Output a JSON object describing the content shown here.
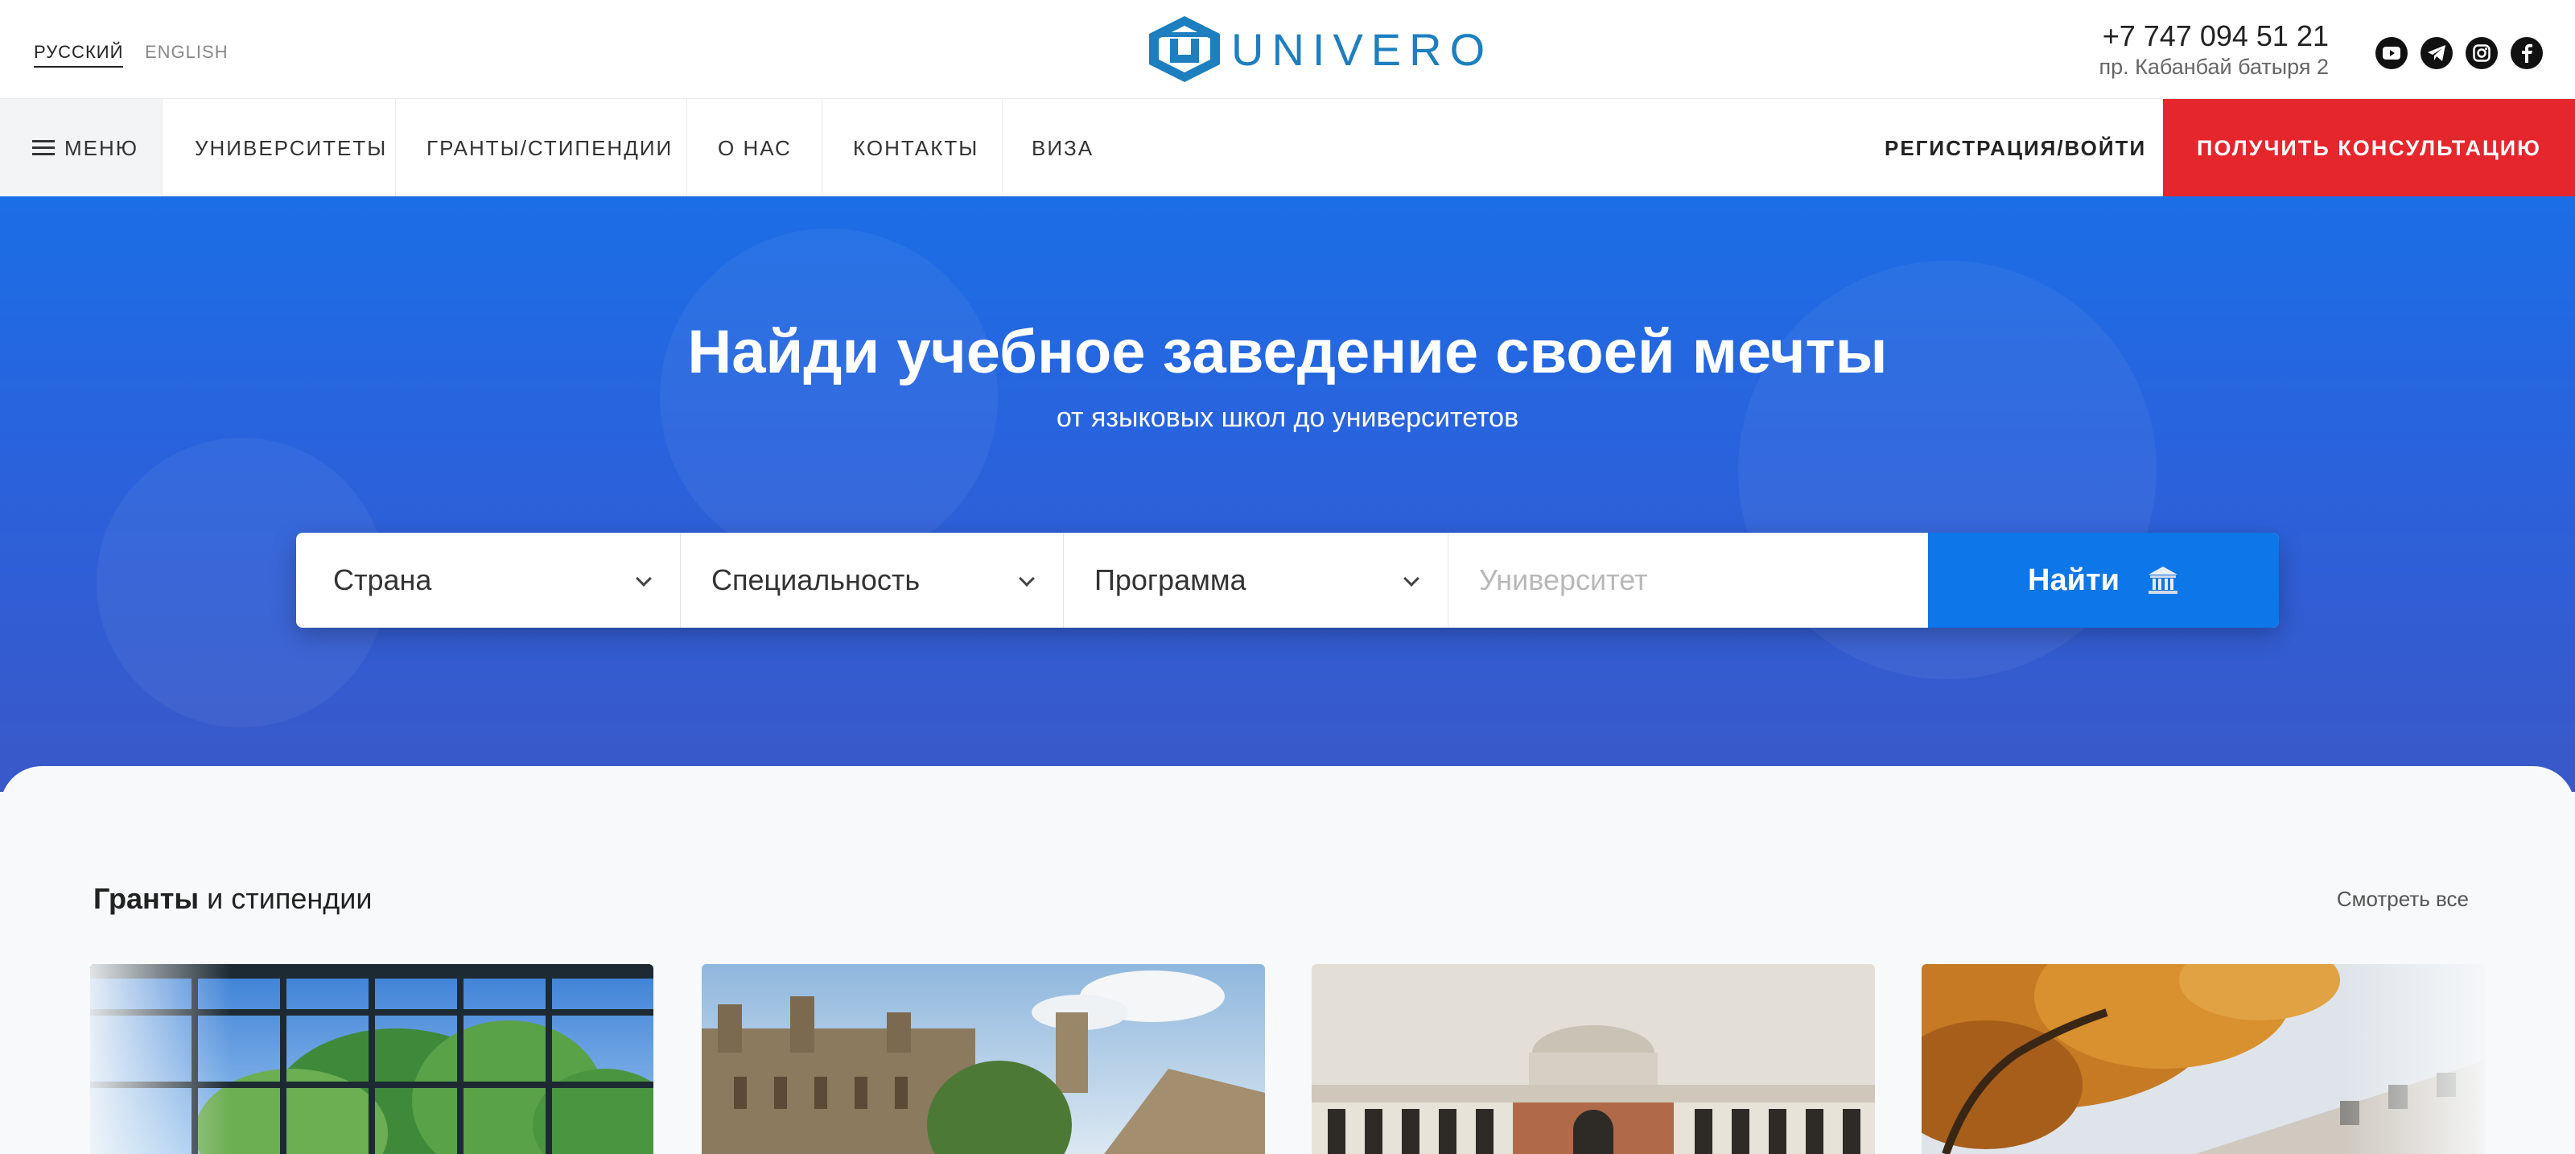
{
  "header": {
    "languages": [
      "РУССКИЙ",
      "ENGLISH"
    ],
    "active_language": "РУССКИЙ",
    "logo_text": "UNIVERO",
    "phone": "+7 747 094 51 21",
    "address": "пр. Кабанбай батыря 2",
    "social_icons": [
      "youtube-icon",
      "telegram-icon",
      "instagram-icon",
      "facebook-icon"
    ]
  },
  "nav": {
    "menu_label": "МЕНЮ",
    "items": [
      "УНИВЕРСИТЕТЫ",
      "ГРАНТЫ/СТИПЕНДИИ",
      "О НАС",
      "КОНТАКТЫ",
      "ВИЗА"
    ],
    "register_label": "РЕГИСТРАЦИЯ/ВОЙТИ",
    "consult_label": "ПОЛУЧИТЬ КОНСУЛЬТАЦИЮ"
  },
  "hero": {
    "title": "Найди учебное заведение своей мечты",
    "subtitle": "от языковых школ до университетов"
  },
  "search": {
    "country_label": "Страна",
    "specialty_label": "Специальность",
    "program_label": "Программа",
    "university_placeholder": "Университет",
    "find_label": "Найти"
  },
  "grants": {
    "title_bold": "Гранты",
    "title_rest": " и стипендии",
    "see_all": "Смотреть все"
  },
  "colors": {
    "brand_blue": "#1d7fc0",
    "hero_blue": "#1b6ee6",
    "button_blue": "#0d76e8",
    "consult_red": "#e5262d"
  }
}
